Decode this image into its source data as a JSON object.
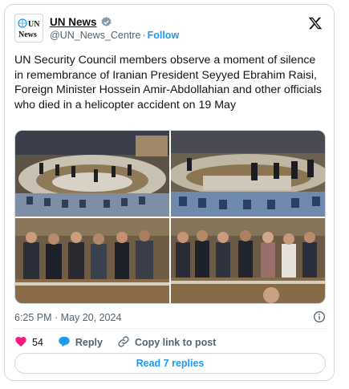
{
  "account": {
    "display_name": "UN News",
    "handle": "@UN_News_Centre",
    "separator": "·",
    "follow_label": "Follow",
    "avatar_text": "UN News"
  },
  "tweet": {
    "text": "UN Security Council members observe a moment of silence in remembrance of Iranian President Seyyed Ebrahim Raisi, Foreign Minister Hossein Amir-Abdollahian and other officials who died in a helicopter accident on 19 May",
    "timestamp": "6:25 PM · May 20, 2024"
  },
  "media": {
    "photos": [
      {
        "name": "council-chamber-wide"
      },
      {
        "name": "council-chamber-standing"
      },
      {
        "name": "members-standing-left"
      },
      {
        "name": "members-standing-right"
      }
    ]
  },
  "actions": {
    "likes_count": "54",
    "reply_label": "Reply",
    "copy_label": "Copy link to post"
  },
  "replies_button": "Read 7 replies",
  "colors": {
    "link_blue": "#1d9bf0",
    "like_red": "#f91880",
    "text_secondary": "#536471",
    "border": "#cfd9de"
  },
  "icons": [
    "verified-badge-icon",
    "x-logo-icon",
    "info-icon",
    "heart-icon",
    "reply-icon",
    "link-icon"
  ]
}
